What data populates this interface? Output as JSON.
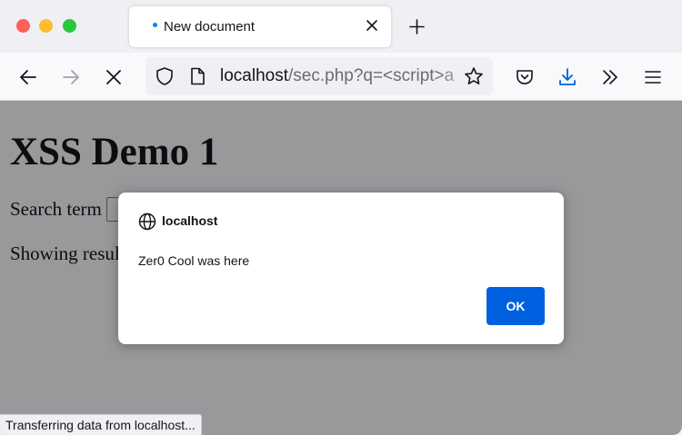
{
  "tab": {
    "title": "New document",
    "close_icon": "close-icon",
    "loading_indicator_color": "#0a84ff"
  },
  "new_tab_icon": "plus-icon",
  "nav": {
    "back_icon": "arrow-left-icon",
    "forward_icon": "arrow-right-icon",
    "stop_icon": "close-icon",
    "url_host": "localhost",
    "url_rest": "/sec.php?q=<script>a",
    "shield_icon": "shield-icon",
    "page_icon": "page-icon",
    "bookmark_icon": "star-icon",
    "pocket_icon": "pocket-icon",
    "downloads_icon": "download-icon",
    "overflow_icon": "chevron-double-right-icon",
    "menu_icon": "hamburger-menu-icon"
  },
  "page": {
    "title": "XSS Demo 1",
    "search_label": "Search term",
    "results_text": "Showing results"
  },
  "status_text": "Transferring data from localhost...",
  "dialog": {
    "origin": "localhost",
    "message": "Zer0 Cool was here",
    "ok_label": "OK",
    "globe_icon": "globe-icon",
    "accent_color": "#0061e0"
  },
  "colors": {
    "traffic_red": "#fe5f57",
    "traffic_yellow": "#febc2e",
    "traffic_green": "#28c840",
    "download_accent": "#0061e0"
  }
}
